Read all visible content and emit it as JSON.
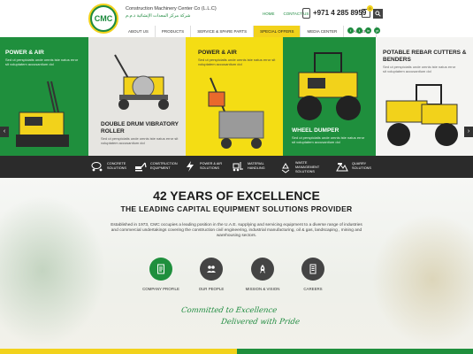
{
  "header": {
    "logo_text": "CMC",
    "company_name_en": "Construction Machinery Center Co (L.L.C)",
    "company_name_ar": "شركة مركز المعدات الإنشائية ذ.م.م",
    "top_links": [
      "HOME",
      "CONTACT US"
    ],
    "phone": "+971 4 285 8959",
    "cart_count": "0"
  },
  "nav": {
    "items": [
      "ABOUT US",
      "PRODUCTS",
      "SERVICE & SPARE PARTS",
      "SPECIAL OFFERS",
      "MEDIA CENTER",
      "CAREERS"
    ],
    "active_index": 3
  },
  "social": [
    "f",
    "t",
    "in",
    "yt"
  ],
  "hero": {
    "panels": [
      {
        "title": "POWER & AIR",
        "text": "Sed ut perspiciatis unde omnis iste natus error sit voluptatem accusantium dol"
      },
      {
        "title": "DOUBLE DRUM VIBRATORY ROLLER",
        "text": "Sed ut perspiciatis unde omnis iste natus error sit voluptatem accusantium dol"
      },
      {
        "title": "POWER & AIR",
        "text": "Sed ut perspiciatis unde omnis iste natus error sit voluptatem accusantium dol"
      },
      {
        "title": "WHEEL DUMPER",
        "text": "Sed ut perspiciatis unde omnis iste natus error sit voluptatem accusantium dol"
      },
      {
        "title": "POTABLE REBAR CUTTERS & BENDERS",
        "text": "Sed ut perspiciatis unde omnis iste natus error sit voluptatem accusantium dol"
      }
    ],
    "prev_arrow": "‹",
    "next_arrow": "›"
  },
  "categories": [
    {
      "label": "CONCRETE SOLUTIONS",
      "icon": "concrete-mixer-icon"
    },
    {
      "label": "CONSTRUCTION EQUIPMENT",
      "icon": "excavator-icon"
    },
    {
      "label": "POWER & AIR SOLUTIONS",
      "icon": "power-icon"
    },
    {
      "label": "MATERIAL HANDLING",
      "icon": "forklift-icon"
    },
    {
      "label": "WASTE MANAGEMENT SOLUTIONS",
      "icon": "recycle-icon"
    },
    {
      "label": "QUARRY SOLUTIONS",
      "icon": "quarry-icon"
    }
  ],
  "main": {
    "headline": "42 YEARS OF EXCELLENCE",
    "subheadline": "THE LEADING CAPITAL EQUIPMENT SOLUTIONS PROVIDER",
    "intro": "Established in 1973, CMC occupies a leading position in the U.A.E. supplying and servicing equipment to a diverse range of industries and commercial undertakings covering the construction civil engineering, industrial manufacturing, oil & gas, landscaping , mining and warehousing sectors.",
    "links": [
      {
        "label": "COMPANY PROFILE",
        "icon": "document-icon",
        "color": "#1f8f3d"
      },
      {
        "label": "OUR PEOPLE",
        "icon": "people-icon",
        "color": "#444444"
      },
      {
        "label": "MISSION & VISION",
        "icon": "rocket-icon",
        "color": "#444444"
      },
      {
        "label": "CAREERS",
        "icon": "briefcase-icon",
        "color": "#444444"
      }
    ],
    "slogan_line1": "Committed to Excellence",
    "slogan_line2": "Delivered with Pride"
  },
  "colors": {
    "brand_green": "#1f8f3d",
    "brand_yellow": "#f2d21b",
    "dark_bar": "#2b2b2b"
  }
}
